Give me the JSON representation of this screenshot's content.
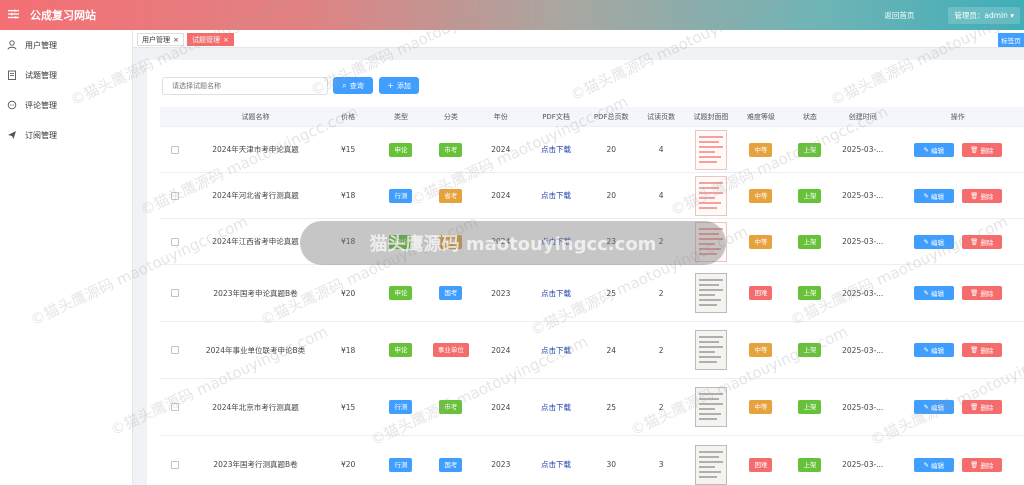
{
  "header": {
    "site_title": "公成复习网站",
    "home_link": "返回首页",
    "admin_label": "管理员：admin"
  },
  "sidebar": {
    "items": [
      {
        "label": "用户管理",
        "icon": "user-icon"
      },
      {
        "label": "试题管理",
        "icon": "document-icon"
      },
      {
        "label": "评论管理",
        "icon": "comment-icon"
      },
      {
        "label": "订阅管理",
        "icon": "send-icon"
      }
    ]
  },
  "tabs": [
    {
      "label": "用户管理",
      "active": false
    },
    {
      "label": "试题管理",
      "active": true
    }
  ],
  "tag_button": "标签页",
  "toolbar": {
    "search_placeholder": "请选择试题名称",
    "query_label": "查询",
    "add_label": "添加"
  },
  "table": {
    "headers": [
      "试题名称",
      "价格",
      "类型",
      "分类",
      "年份",
      "PDF文档",
      "PDF总页数",
      "试读页数",
      "试题封面图",
      "难度等级",
      "状态",
      "创建时间",
      "操作"
    ],
    "rows": [
      {
        "name": "2024年天津市考申论真题",
        "price": "¥15",
        "type": "申论",
        "category": "市考",
        "year": "2024",
        "pdf": "点击下载",
        "pages": "20",
        "trial": "4",
        "difficulty": "中等",
        "status": "上架",
        "created": "2025-03-...",
        "edit": "编辑",
        "delete": "删除"
      },
      {
        "name": "2024年河北省考行测真题",
        "price": "¥18",
        "type": "行测",
        "category": "省考",
        "year": "2024",
        "pdf": "点击下载",
        "pages": "20",
        "trial": "4",
        "difficulty": "中等",
        "status": "上架",
        "created": "2025-03-...",
        "edit": "编辑",
        "delete": "删除"
      },
      {
        "name": "2024年江西省考申论真题",
        "price": "¥18",
        "type": "申论",
        "category": "省考",
        "year": "2024",
        "pdf": "点击下载",
        "pages": "23",
        "trial": "2",
        "difficulty": "中等",
        "status": "上架",
        "created": "2025-03-...",
        "edit": "编辑",
        "delete": "删除"
      },
      {
        "name": "2023年国考申论真题B卷",
        "price": "¥20",
        "type": "申论",
        "category": "国考",
        "year": "2023",
        "pdf": "点击下载",
        "pages": "25",
        "trial": "2",
        "difficulty": "困难",
        "status": "上架",
        "created": "2025-03-...",
        "edit": "编辑",
        "delete": "删除"
      },
      {
        "name": "2024年事业单位联考申论B类",
        "price": "¥18",
        "type": "申论",
        "category": "事业单位",
        "year": "2024",
        "pdf": "点击下载",
        "pages": "24",
        "trial": "2",
        "difficulty": "中等",
        "status": "上架",
        "created": "2025-03-...",
        "edit": "编辑",
        "delete": "删除"
      },
      {
        "name": "2024年北京市考行测真题",
        "price": "¥15",
        "type": "行测",
        "category": "市考",
        "year": "2024",
        "pdf": "点击下载",
        "pages": "25",
        "trial": "2",
        "difficulty": "中等",
        "status": "上架",
        "created": "2025-03-...",
        "edit": "编辑",
        "delete": "删除"
      },
      {
        "name": "2023年国考行测真题B卷",
        "price": "¥20",
        "type": "行测",
        "category": "国考",
        "year": "2023",
        "pdf": "点击下载",
        "pages": "30",
        "trial": "3",
        "difficulty": "困难",
        "status": "上架",
        "created": "2025-03-...",
        "edit": "编辑",
        "delete": "删除"
      }
    ]
  },
  "watermark": {
    "overlay_text": "猫头鹰源码 maotouyingcc.com",
    "tile_text": "©猫头鹰源码 maotouyingcc.com"
  },
  "colors": {
    "primary": "#409eff",
    "success": "#67c23a",
    "warning": "#e6a23c",
    "danger": "#f56c6c"
  }
}
